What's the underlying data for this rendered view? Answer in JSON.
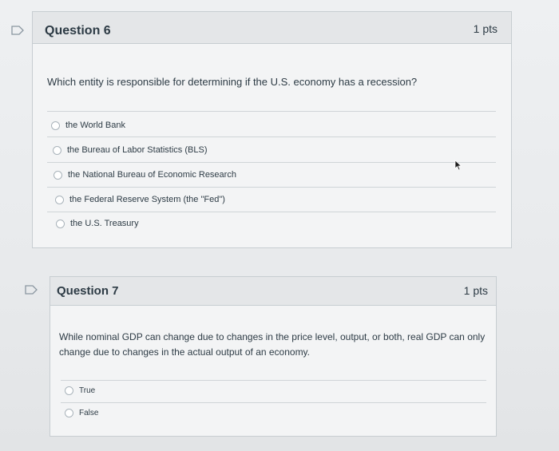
{
  "questions": [
    {
      "title": "Question 6",
      "points": "1 pts",
      "text": "Which entity is responsible for determining if the U.S. economy has a recession?",
      "answers": [
        "the World Bank",
        "the Bureau of Labor Statistics (BLS)",
        "the National Bureau of Economic Research",
        "the Federal Reserve System (the \"Fed\")",
        "the U.S. Treasury"
      ]
    },
    {
      "title": "Question 7",
      "points": "1 pts",
      "text": "While nominal GDP can change due to changes in the price level, output, or both, real GDP can only change due to changes in the actual output of an economy.",
      "answers": [
        "True",
        "False"
      ]
    }
  ],
  "icons": {
    "flag": "flag-question-icon",
    "cursor": "mouse-pointer-icon"
  },
  "colors": {
    "accent": "#2d3b45",
    "border": "#c7cdd1",
    "header": "#e4e6e8"
  }
}
